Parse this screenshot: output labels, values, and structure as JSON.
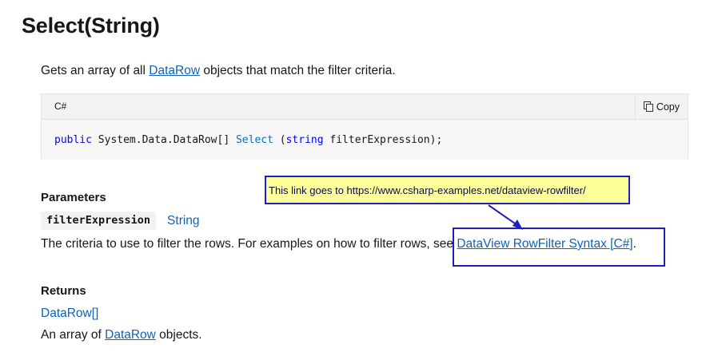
{
  "title": "Select(String)",
  "summary": {
    "prefix": "Gets an array of all ",
    "link": "DataRow",
    "suffix": " objects that match the filter criteria."
  },
  "code": {
    "language": "C#",
    "copy_label": "Copy",
    "copy_icon": "copy-icon",
    "tokens": {
      "kw_public": "public",
      "type": " System.Data.DataRow[] ",
      "method": "Select",
      "open": " (",
      "kw_string": "string",
      "rest": " filterExpression);"
    }
  },
  "parameters": {
    "heading": "Parameters",
    "name": "filterExpression",
    "type": "String",
    "desc_prefix": "The criteria to use to filter the rows. For examples on how to filter rows, see ",
    "desc_link": "DataView RowFilter Syntax [C#]",
    "desc_suffix": "."
  },
  "returns": {
    "heading": "Returns",
    "type": "DataRow[]",
    "desc_prefix": "An array of ",
    "desc_link": "DataRow",
    "desc_suffix": " objects."
  },
  "annotation": {
    "callout_text": "This link goes to https://www.csharp-examples.net/dataview-rowfilter/",
    "box_color": "#1f1fbf",
    "callout_bg": "#ffff99"
  },
  "colors": {
    "link": "#0f63b8",
    "keyword": "#0101fd",
    "method": "#0a72ad"
  }
}
